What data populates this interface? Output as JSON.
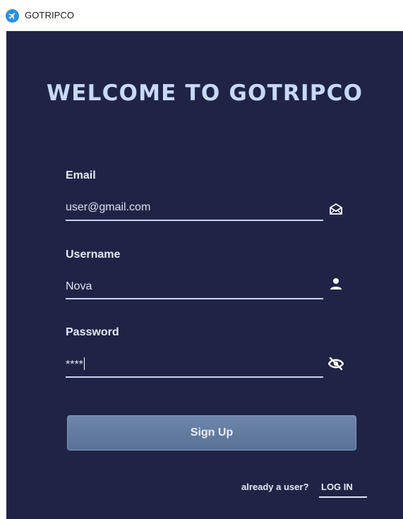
{
  "window": {
    "title": "GOTRIPCO",
    "icon": "airplane-icon"
  },
  "form": {
    "heading": "WELCOME TO GOTRIPCO",
    "email": {
      "label": "Email",
      "value": "user@gmail.com",
      "icon": "envelope-icon"
    },
    "username": {
      "label": "Username",
      "value": "Nova",
      "icon": "user-icon"
    },
    "password": {
      "label": "Password",
      "value": "****",
      "icon": "eye-slash-icon"
    },
    "submit_label": "Sign Up",
    "already_text": "already a user?",
    "login_label": "LOG IN"
  },
  "colors": {
    "panel_background": "#1f2447",
    "heading": "#c9d8f5",
    "button": "#647ca1"
  }
}
